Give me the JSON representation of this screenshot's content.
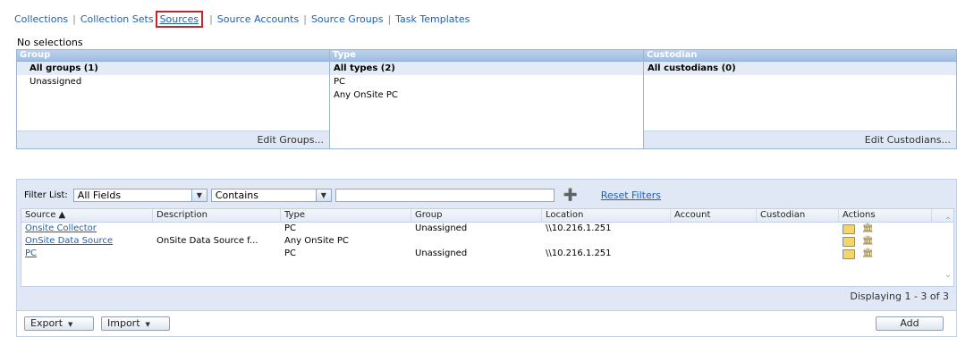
{
  "nav": {
    "items": [
      "Collections",
      "Collection Sets",
      "Sources",
      "Source Accounts",
      "Source Groups",
      "Task Templates"
    ],
    "active": "Sources"
  },
  "selection_status": "No selections",
  "panels": {
    "group": {
      "header": "Group",
      "items": [
        "All groups (1)",
        "Unassigned"
      ],
      "footer_button": "Edit Groups..."
    },
    "type": {
      "header": "Type",
      "items": [
        "All types (2)",
        "PC",
        "Any OnSite PC"
      ]
    },
    "custodian": {
      "header": "Custodian",
      "items": [
        "All custodians (0)"
      ],
      "footer_button": "Edit Custodians..."
    }
  },
  "filter": {
    "label": "Filter List:",
    "field_value": "All Fields",
    "operator_value": "Contains",
    "text_value": "",
    "reset_label": "Reset Filters"
  },
  "table": {
    "columns": [
      "Source ▲",
      "Description",
      "Type",
      "Group",
      "Location",
      "Account",
      "Custodian",
      "Actions"
    ],
    "rows": [
      {
        "source": "Onsite Collector",
        "description": "",
        "type": "PC",
        "group": "Unassigned",
        "location": "\\\\10.216.1.251",
        "account": "",
        "custodian": ""
      },
      {
        "source": "OnSite Data Source",
        "description": "OnSite Data Source f...",
        "type": "Any OnSite PC",
        "group": "",
        "location": "",
        "account": "",
        "custodian": ""
      },
      {
        "source": "PC",
        "description": "",
        "type": "PC",
        "group": "Unassigned",
        "location": "\\\\10.216.1.251",
        "account": "",
        "custodian": ""
      }
    ],
    "display_status": "Displaying 1 - 3 of 3"
  },
  "footer": {
    "export_label": "Export",
    "import_label": "Import",
    "add_label": "Add"
  },
  "icons": {
    "edit": "edit-icon",
    "delete": "trash-icon",
    "add_filter": "add-filter-icon"
  },
  "colors": {
    "link": "#1f5fb0",
    "panel_header": "#9fbde2",
    "grid_background": "#dfe8f4",
    "active_tab_border": "#c0262c"
  }
}
